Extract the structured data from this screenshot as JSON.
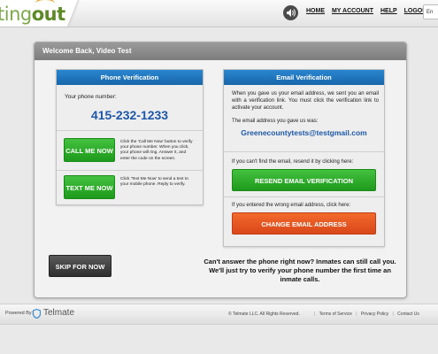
{
  "header": {
    "logo_main": "ting",
    "logo_accent": "out",
    "nav": [
      "HOME",
      "MY ACCOUNT",
      "HELP",
      "LOGOUT"
    ],
    "language": "En"
  },
  "panel": {
    "welcome": "Welcome Back, Video Test"
  },
  "phone_verification": {
    "title": "Phone Verification",
    "label": "Your phone number:",
    "number": "415-232-1233",
    "call_button": "CALL ME NOW",
    "call_desc": "Click the 'Call Me Now' button to verify your phone number. When you click, your phone will ring. Answer it, and enter the code on the screen.",
    "text_button": "TEXT ME NOW",
    "text_desc": "Click 'Text Me Now' to send a text to your mobile phone. Reply to verify."
  },
  "email_verification": {
    "title": "Email Verification",
    "intro": "When you gave us your email address, we sent you an email with a verification link. You must click the verification link to activate your account.",
    "address_label": "The email address you gave us was:",
    "address": "Greenecountytests@testgmail.com",
    "resend_prompt": "If you can't find the email, resend it by clicking here:",
    "resend_button": "RESEND EMAIL VERIFICATION",
    "change_prompt": "If you entered the wrong email address, click here:",
    "change_button": "CHANGE EMAIL ADDRESS"
  },
  "skip": {
    "button": "SKIP FOR NOW",
    "note": "Can't answer the phone right now? Inmates can still call you. We'll just try to verify your phone number the first time an inmate calls."
  },
  "footer": {
    "powered_by": "Powered By:",
    "brand": "Telmate",
    "copyright": "© Telmate LLC. All Rights Reserved.",
    "links": [
      "Terms of Service",
      "Privacy Policy",
      "Contact Us"
    ]
  },
  "colors": {
    "accent_blue": "#1766ab",
    "green": "#1f9a1c",
    "orange": "#d9471a"
  }
}
